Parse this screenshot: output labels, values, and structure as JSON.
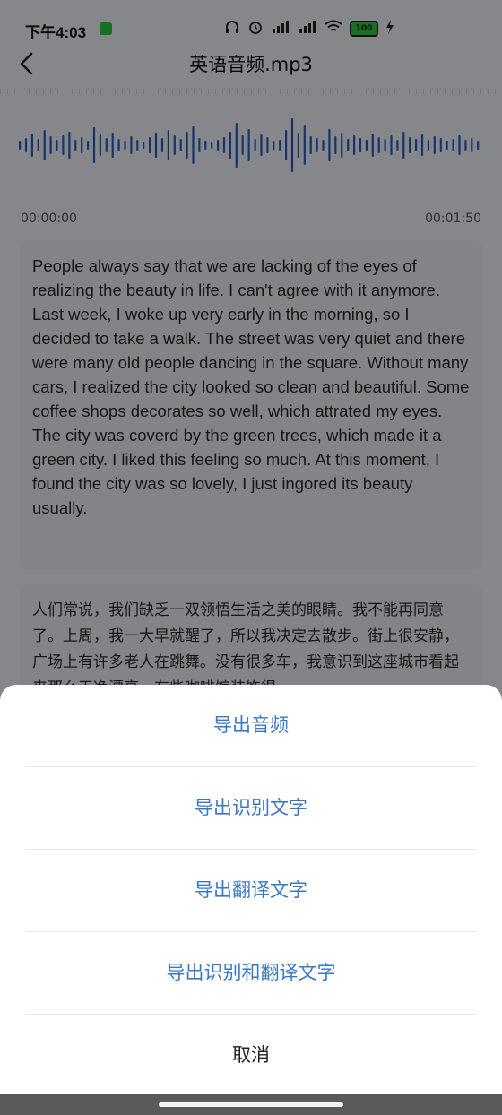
{
  "status_bar": {
    "time": "下午4:03",
    "battery": "100"
  },
  "header": {
    "title": "英语音频.mp3"
  },
  "player": {
    "start_time": "00:00:00",
    "end_time": "00:01:50"
  },
  "transcript": {
    "english": "People always say that we are lacking of the eyes of realizing the beauty in life. I can't agree with it anymore. Last week, I woke up very early in the morning, so I decided to take a walk. The street was very quiet and there were many old people dancing in the square. Without many cars, I realized the city looked so clean and beautiful. Some coffee shops decorates so well, which attrated my eyes. The city was coverd by the green trees, which made it a green city. I liked this feeling so much. At this moment, I found the city was so lovely, I just ingored its beauty usually.",
    "chinese": "人们常说，我们缺乏一双领悟生活之美的眼睛。我不能再同意了。上周，我一大早就醒了，所以我决定去散步。街上很安静，广场上有许多老人在跳舞。没有很多车，我意识到这座城市看起来那么干净漂亮。有些咖啡馆装饰得"
  },
  "export_sheet": {
    "export_audio": "导出音频",
    "export_recognized": "导出识别文字",
    "export_translated": "导出翻译文字",
    "export_both": "导出识别和翻译文字",
    "cancel": "取消"
  },
  "colors": {
    "accent": "#3a78c4",
    "waveform": "#2c5cc5"
  }
}
